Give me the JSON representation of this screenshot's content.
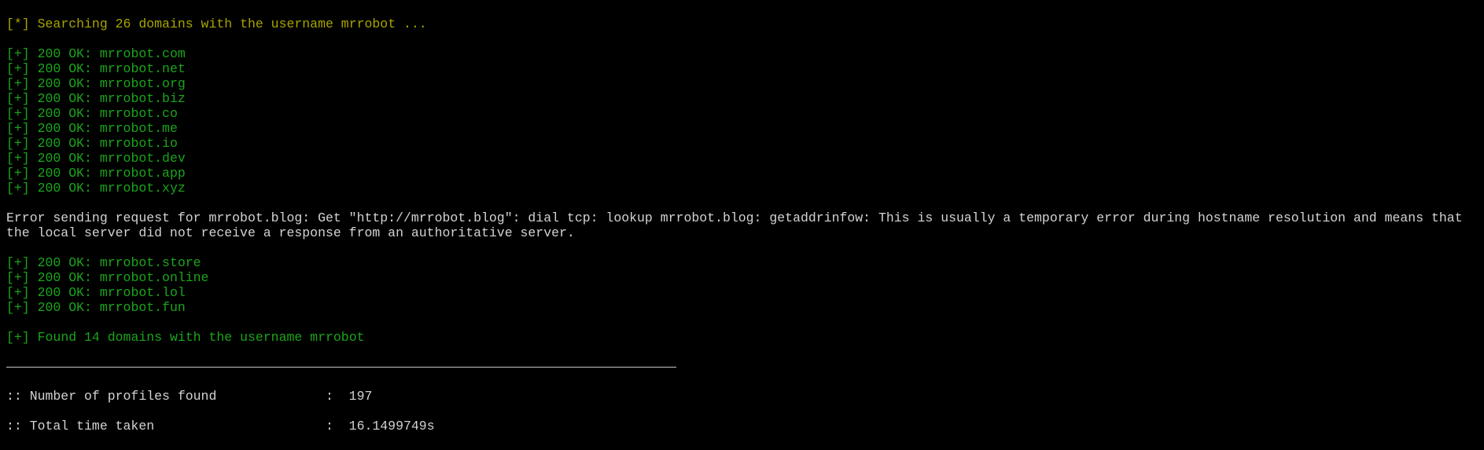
{
  "header": {
    "prefix": "[*]",
    "text": "Searching 26 domains with the username mrrobot ..."
  },
  "results_before": [
    {
      "prefix": "[+]",
      "text": "200 OK: mrrobot.com"
    },
    {
      "prefix": "[+]",
      "text": "200 OK: mrrobot.net"
    },
    {
      "prefix": "[+]",
      "text": "200 OK: mrrobot.org"
    },
    {
      "prefix": "[+]",
      "text": "200 OK: mrrobot.biz"
    },
    {
      "prefix": "[+]",
      "text": "200 OK: mrrobot.co"
    },
    {
      "prefix": "[+]",
      "text": "200 OK: mrrobot.me"
    },
    {
      "prefix": "[+]",
      "text": "200 OK: mrrobot.io"
    },
    {
      "prefix": "[+]",
      "text": "200 OK: mrrobot.dev"
    },
    {
      "prefix": "[+]",
      "text": "200 OK: mrrobot.app"
    },
    {
      "prefix": "[+]",
      "text": "200 OK: mrrobot.xyz"
    }
  ],
  "error": "Error sending request for mrrobot.blog: Get \"http://mrrobot.blog\": dial tcp: lookup mrrobot.blog: getaddrinfow: This is usually a temporary error during hostname resolution and means that the local server did not receive a response from an authoritative server.",
  "results_after": [
    {
      "prefix": "[+]",
      "text": "200 OK: mrrobot.store"
    },
    {
      "prefix": "[+]",
      "text": "200 OK: mrrobot.online"
    },
    {
      "prefix": "[+]",
      "text": "200 OK: mrrobot.lol"
    },
    {
      "prefix": "[+]",
      "text": "200 OK: mrrobot.fun"
    }
  ],
  "summary": {
    "prefix": "[+]",
    "text": "Found 14 domains with the username mrrobot"
  },
  "stats": [
    {
      "label": ":: Number of profiles found              :  ",
      "value": "197"
    },
    {
      "label": ":: Total time taken                      :  ",
      "value": "16.1499749s"
    }
  ]
}
